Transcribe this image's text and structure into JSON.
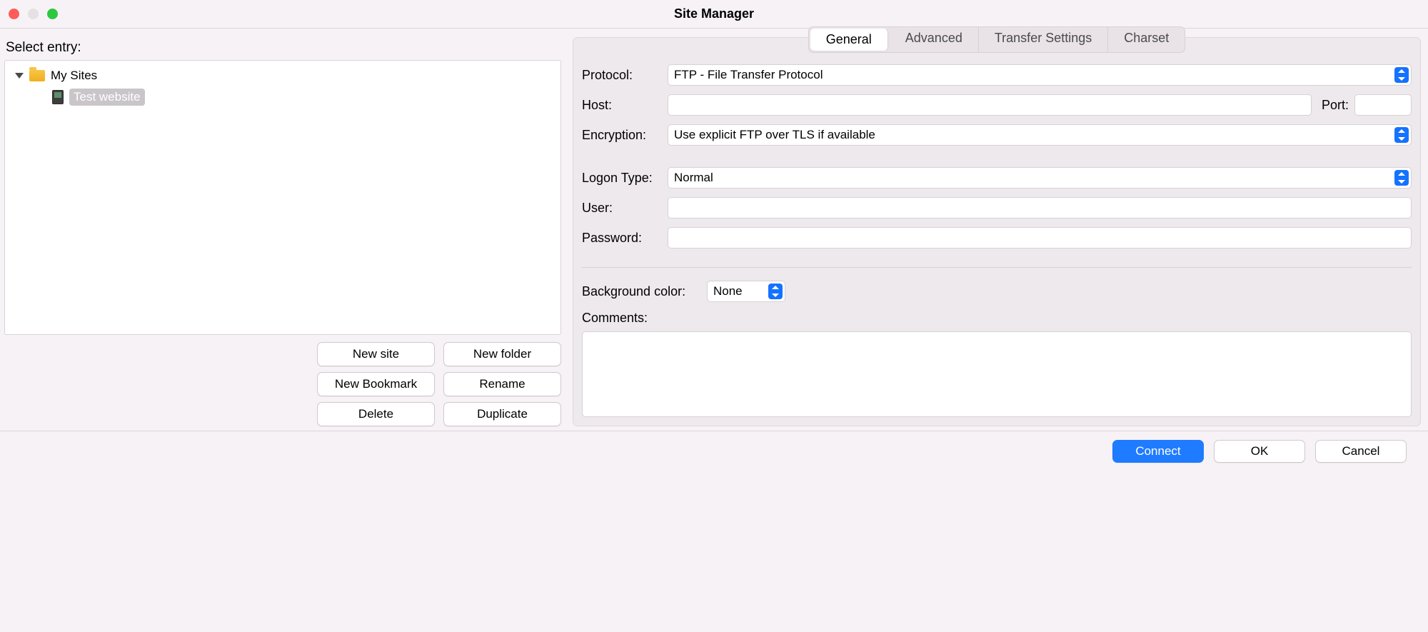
{
  "window": {
    "title": "Site Manager"
  },
  "left": {
    "select_label": "Select entry:",
    "tree": {
      "root": {
        "label": "My Sites"
      },
      "child": {
        "label": "Test website"
      }
    },
    "buttons": {
      "new_site": "New site",
      "new_folder": "New folder",
      "new_bookmark": "New Bookmark",
      "rename": "Rename",
      "delete": "Delete",
      "duplicate": "Duplicate"
    }
  },
  "tabs": {
    "general": "General",
    "advanced": "Advanced",
    "transfer": "Transfer Settings",
    "charset": "Charset"
  },
  "form": {
    "protocol_label": "Protocol:",
    "protocol_value": "FTP - File Transfer Protocol",
    "host_label": "Host:",
    "host_value": "",
    "port_label": "Port:",
    "port_value": "",
    "encryption_label": "Encryption:",
    "encryption_value": "Use explicit FTP over TLS if available",
    "logon_label": "Logon Type:",
    "logon_value": "Normal",
    "user_label": "User:",
    "user_value": "",
    "password_label": "Password:",
    "password_value": "",
    "bg_label": "Background color:",
    "bg_value": "None",
    "comments_label": "Comments:",
    "comments_value": ""
  },
  "footer": {
    "connect": "Connect",
    "ok": "OK",
    "cancel": "Cancel"
  }
}
